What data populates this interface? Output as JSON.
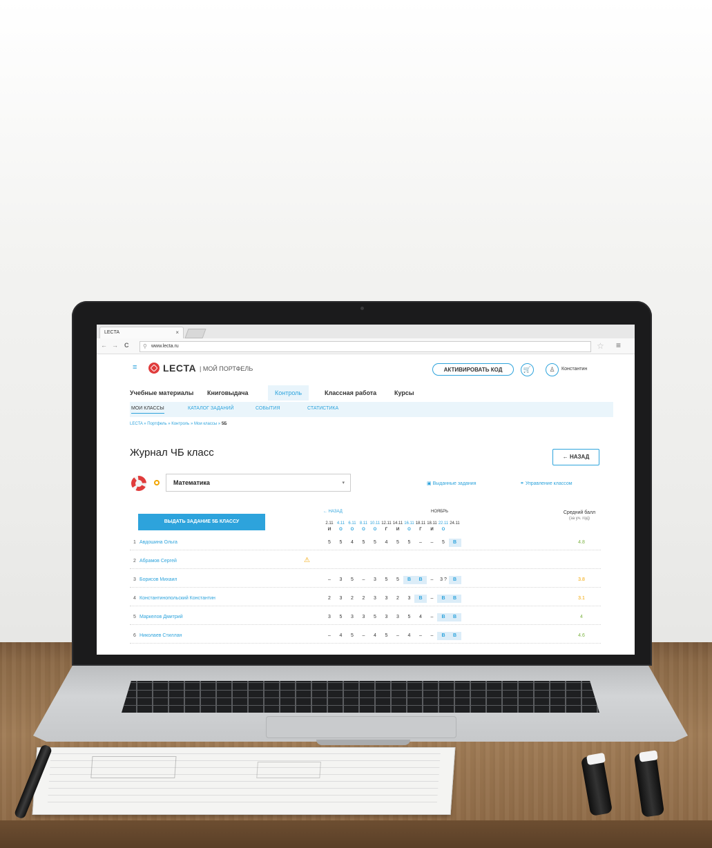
{
  "browser": {
    "tab_title": "LECTA",
    "tab_close": "×",
    "back": "←",
    "forward": "→",
    "reload": "C",
    "url": "www.lecta.ru",
    "star": "☆",
    "menu": "≡"
  },
  "header": {
    "brand": "LECTA",
    "brand_sub": "| МОЙ ПОРТФЕЛЬ",
    "activate_label": "АКТИВИРОВАТЬ КОД",
    "user_name": "Константин"
  },
  "main_nav": [
    {
      "label": "Учебные материалы"
    },
    {
      "label": "Книговыдача"
    },
    {
      "label": "Контроль"
    },
    {
      "label": "Классная работа"
    },
    {
      "label": "Курсы"
    }
  ],
  "sub_nav": [
    {
      "label": "МОИ КЛАССЫ"
    },
    {
      "label": "КАТАЛОГ ЗАДАНИЙ"
    },
    {
      "label": "СОБЫТИЯ"
    },
    {
      "label": "СТАТИСТИКА"
    }
  ],
  "breadcrumb": {
    "path": "LECTA » Портфель » Контроль » Мои классы » ",
    "current": "5Б"
  },
  "page": {
    "title": "Журнал ЧБ класс",
    "back_label": "← НАЗАД",
    "subject": "Математика",
    "link_issued": "Выданные задания",
    "link_manage": "Управление классом",
    "assign_label": "ВЫДАТЬ ЗАДАНИЕ 5Б КЛАССУ"
  },
  "journal": {
    "back_label": "← НАЗАД",
    "month": "НОЯБРЬ",
    "avg_label": "Средний балл",
    "avg_sub": "(за уч. год)",
    "dates": [
      {
        "date": "2.11",
        "type": "И"
      },
      {
        "date": "4.11",
        "type": "О"
      },
      {
        "date": "6.11",
        "type": "О"
      },
      {
        "date": "8.11",
        "type": "О"
      },
      {
        "date": "10.11",
        "type": "О"
      },
      {
        "date": "12.11",
        "type": "Г"
      },
      {
        "date": "14.11",
        "type": "И"
      },
      {
        "date": "16.11",
        "type": "О"
      },
      {
        "date": "18.11",
        "type": "Г"
      },
      {
        "date": "18.11",
        "type": "И"
      },
      {
        "date": "22.11",
        "type": "О"
      },
      {
        "date": "24.11",
        "type": ""
      }
    ],
    "students": [
      {
        "num": "1",
        "name": "Авдошина Ольга",
        "grades": [
          "5",
          "5",
          "4",
          "5",
          "5",
          "4",
          "5",
          "5",
          "–",
          "–",
          "5",
          "В"
        ],
        "avg": "4.8",
        "avg_color": "#7cb342"
      },
      {
        "num": "2",
        "name": "Абрамов Сергей",
        "grades": [
          "",
          "",
          "",
          "",
          "",
          "",
          "",
          "",
          "",
          "",
          "",
          ""
        ],
        "avg": "",
        "avg_color": "#7cb342"
      },
      {
        "num": "3",
        "name": "Борисов Михаил",
        "grades": [
          "–",
          "3",
          "5",
          "–",
          "3",
          "5",
          "5",
          "В",
          "В",
          "–",
          "3 ?",
          "В"
        ],
        "avg": "3.8",
        "avg_color": "#f2a500"
      },
      {
        "num": "4",
        "name": "Константинопольский Константин",
        "grades": [
          "2",
          "3",
          "2",
          "2",
          "3",
          "3",
          "2",
          "3",
          "В",
          "–",
          "В",
          "В"
        ],
        "avg": "3.1",
        "avg_color": "#f2a500"
      },
      {
        "num": "5",
        "name": "Маркелов Дмитрий",
        "grades": [
          "3",
          "5",
          "3",
          "3",
          "5",
          "3",
          "3",
          "5",
          "4",
          "–",
          "В",
          "В"
        ],
        "avg": "4",
        "avg_color": "#7cb342"
      },
      {
        "num": "6",
        "name": "Николаев Стиллан",
        "grades": [
          "–",
          "4",
          "5",
          "–",
          "4",
          "5",
          "–",
          "4",
          "–",
          "–",
          "В",
          "В"
        ],
        "avg": "4.6",
        "avg_color": "#7cb342"
      }
    ]
  },
  "colors": {
    "accent": "#2da3dc",
    "logo": "#e03c3c",
    "warning": "#f2a500"
  }
}
